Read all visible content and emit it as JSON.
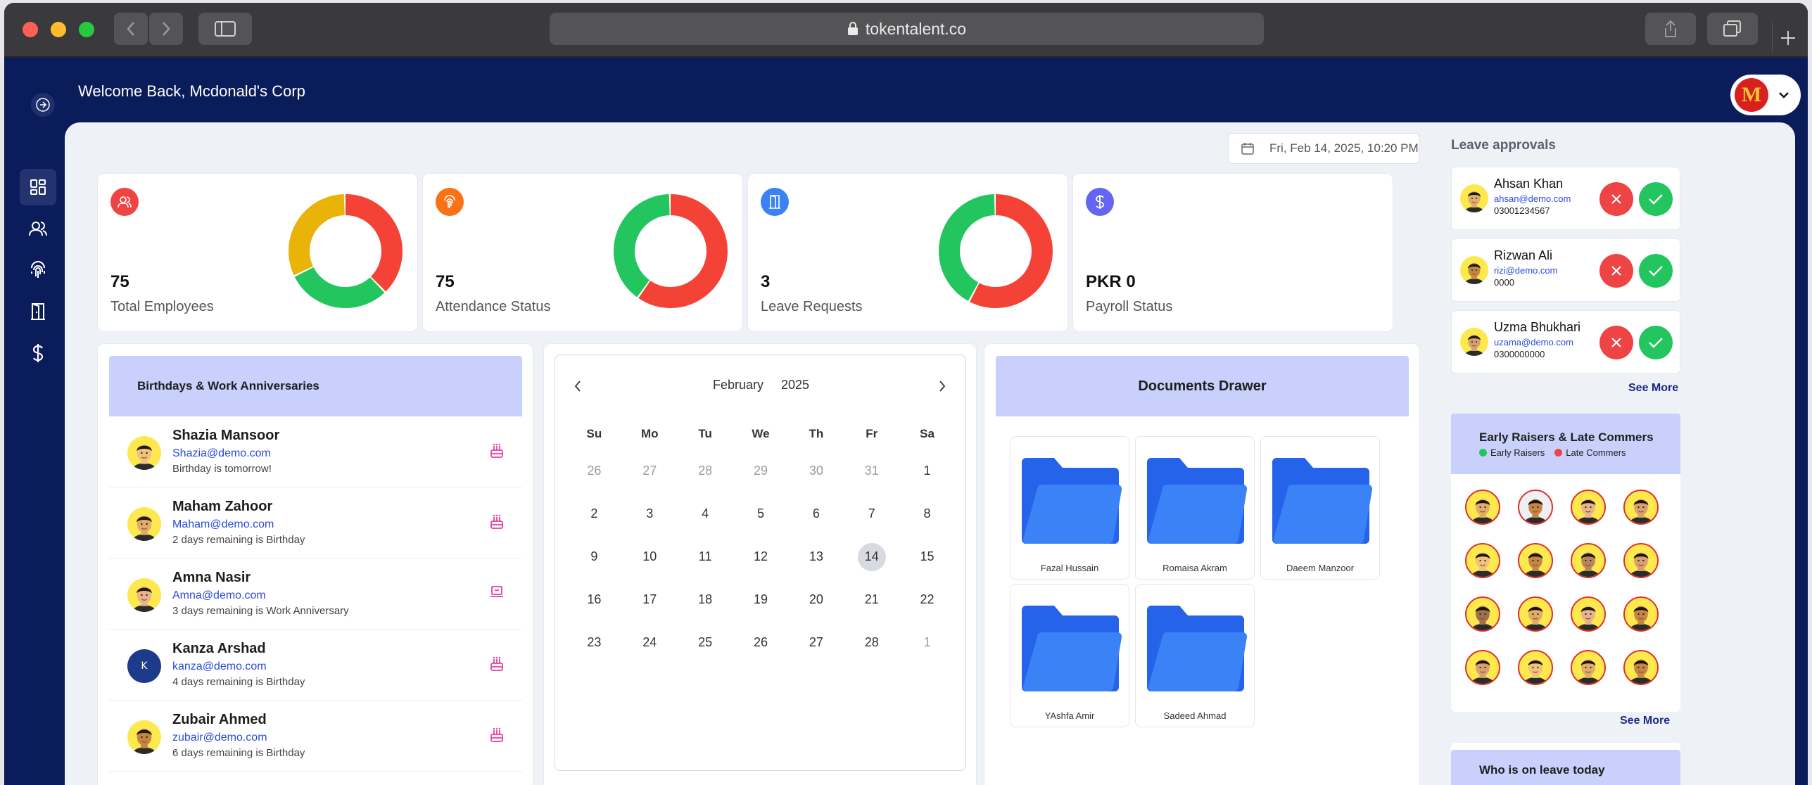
{
  "browser": {
    "url": "tokentalent.co"
  },
  "header": {
    "welcome": "Welcome Back, Mcdonald's Corp",
    "logo_letter": "M"
  },
  "sidebar": {
    "items": [
      "dashboard-icon",
      "users-icon",
      "fingerprint-icon",
      "door-icon",
      "dollar-icon"
    ]
  },
  "datetime": "Fri, Feb 14, 2025, 10:20 PM",
  "stats": [
    {
      "value": "75",
      "label": "Total Employees",
      "icon": "users-icon",
      "color": "#ee4444",
      "donut": [
        {
          "v": 38,
          "c": "#f44336"
        },
        {
          "v": 30,
          "c": "#22c55e"
        },
        {
          "v": 32,
          "c": "#eab308"
        }
      ]
    },
    {
      "value": "75",
      "label": "Attendance Status",
      "icon": "fingerprint-icon",
      "color": "#f97316",
      "donut": [
        {
          "v": 60,
          "c": "#f44336"
        },
        {
          "v": 40,
          "c": "#22c55e"
        }
      ]
    },
    {
      "value": "3",
      "label": "Leave Requests",
      "icon": "door-icon",
      "color": "#3b82f6",
      "donut": [
        {
          "v": 58,
          "c": "#f44336"
        },
        {
          "v": 42,
          "c": "#22c55e"
        }
      ]
    },
    {
      "value": "PKR 0",
      "label": "Payroll Status",
      "icon": "dollar-icon",
      "color": "#6366f1",
      "donut": []
    }
  ],
  "birthdays": {
    "title": "Birthdays & Work Anniversaries",
    "items": [
      {
        "name": "Shazia Mansoor",
        "email": "Shazia@demo.com",
        "note": "Birthday is tomorrow!",
        "icon": "cake-icon"
      },
      {
        "name": "Maham Zahoor",
        "email": "Maham@demo.com",
        "note": "2 days remaining is Birthday",
        "icon": "cake-icon"
      },
      {
        "name": "Amna Nasir",
        "email": "Amna@demo.com",
        "note": "3 days remaining is Work Anniversary",
        "icon": "laptop-icon"
      },
      {
        "name": "Kanza Arshad",
        "email": "kanza@demo.com",
        "note": "4 days remaining is Birthday",
        "icon": "cake-icon",
        "initial": "K"
      },
      {
        "name": "Zubair Ahmed",
        "email": "zubair@demo.com",
        "note": "6 days remaining is Birthday",
        "icon": "cake-icon"
      }
    ]
  },
  "calendar": {
    "month": "February",
    "year": "2025",
    "weekdays": [
      "Su",
      "Mo",
      "Tu",
      "We",
      "Th",
      "Fr",
      "Sa"
    ],
    "days": [
      {
        "d": "26",
        "m": true
      },
      {
        "d": "27",
        "m": true
      },
      {
        "d": "28",
        "m": true
      },
      {
        "d": "29",
        "m": true
      },
      {
        "d": "30",
        "m": true
      },
      {
        "d": "31",
        "m": true
      },
      {
        "d": "1"
      },
      {
        "d": "2"
      },
      {
        "d": "3"
      },
      {
        "d": "4"
      },
      {
        "d": "5"
      },
      {
        "d": "6"
      },
      {
        "d": "7"
      },
      {
        "d": "8"
      },
      {
        "d": "9"
      },
      {
        "d": "10"
      },
      {
        "d": "11"
      },
      {
        "d": "12"
      },
      {
        "d": "13"
      },
      {
        "d": "14",
        "t": true
      },
      {
        "d": "15"
      },
      {
        "d": "16"
      },
      {
        "d": "17"
      },
      {
        "d": "18"
      },
      {
        "d": "19"
      },
      {
        "d": "20"
      },
      {
        "d": "21"
      },
      {
        "d": "22"
      },
      {
        "d": "23"
      },
      {
        "d": "24"
      },
      {
        "d": "25"
      },
      {
        "d": "26"
      },
      {
        "d": "27"
      },
      {
        "d": "28"
      },
      {
        "d": "1",
        "m": true
      }
    ]
  },
  "documents": {
    "title": "Documents Drawer",
    "folders": [
      "Fazal Hussain",
      "Romaisa Akram",
      "Daeem Manzoor",
      "YAshfa Amir",
      "Sadeed Ahmad"
    ]
  },
  "leave_approvals": {
    "title": "Leave approvals",
    "items": [
      {
        "name": "Ahsan Khan",
        "email": "ahsan@demo.com",
        "phone": "03001234567"
      },
      {
        "name": "Rizwan Ali",
        "email": "rizi@demo.com",
        "phone": "0000"
      },
      {
        "name": "Uzma Bhukhari",
        "email": "uzama@demo.com",
        "phone": "0300000000"
      }
    ],
    "see_more": "See More"
  },
  "early_raisers": {
    "title": "Early Raisers & Late Commers",
    "legend": [
      {
        "label": "Early Raisers",
        "color": "#22c55e"
      },
      {
        "label": "Late Commers",
        "color": "#ef4444"
      }
    ],
    "see_more": "See More"
  },
  "on_leave": {
    "title": "Who is on leave today"
  }
}
